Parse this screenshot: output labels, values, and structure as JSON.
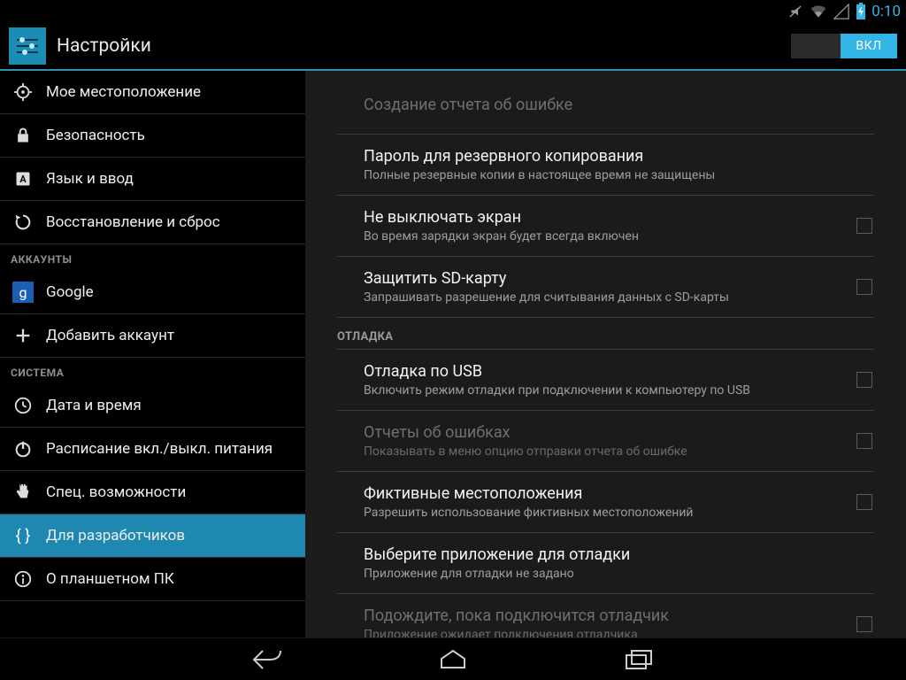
{
  "status": {
    "time": "0:10"
  },
  "actionbar": {
    "title": "Настройки",
    "toggle_label": "ВКЛ"
  },
  "sidebar": {
    "items": [
      {
        "label": "Мое местоположение"
      },
      {
        "label": "Безопасность"
      },
      {
        "label": "Язык и ввод"
      },
      {
        "label": "Восстановление и сброс"
      }
    ],
    "cat_accounts": "АККАУНТЫ",
    "accounts": [
      {
        "label": "Google"
      },
      {
        "label": "Добавить аккаунт"
      }
    ],
    "cat_system": "СИСТЕМА",
    "system": [
      {
        "label": "Дата и время"
      },
      {
        "label": "Расписание вкл./выкл. питания"
      },
      {
        "label": "Спец. возможности"
      },
      {
        "label": "Для разработчиков"
      },
      {
        "label": "О планшетном ПК"
      }
    ]
  },
  "detail": {
    "rows": [
      {
        "title": "Создание отчета об ошибке",
        "sub": ""
      },
      {
        "title": "Пароль для резервного копирования",
        "sub": "Полные резервные копии в настоящее время не защищены"
      },
      {
        "title": "Не выключать экран",
        "sub": "Во время зарядки экран будет всегда включен"
      },
      {
        "title": "Защитить SD-карту",
        "sub": "Запрашивать разрешение для считывания данных с SD-карты"
      }
    ],
    "cat_debug": "ОТЛАДКА",
    "debug": [
      {
        "title": "Отладка по USB",
        "sub": "Включить режим отладки при подключении к компьютеру по USB"
      },
      {
        "title": "Отчеты об ошибках",
        "sub": "Показывать в меню опцию отправки отчета об ошибке"
      },
      {
        "title": "Фиктивные местоположения",
        "sub": "Разрешить использование фиктивных местоположений"
      },
      {
        "title": "Выберите приложение для отладки",
        "sub": "Приложение для отладки не задано"
      },
      {
        "title": "Подождите, пока подключится отладчик",
        "sub": "Приложение ожидает подключения отладчика"
      }
    ]
  }
}
